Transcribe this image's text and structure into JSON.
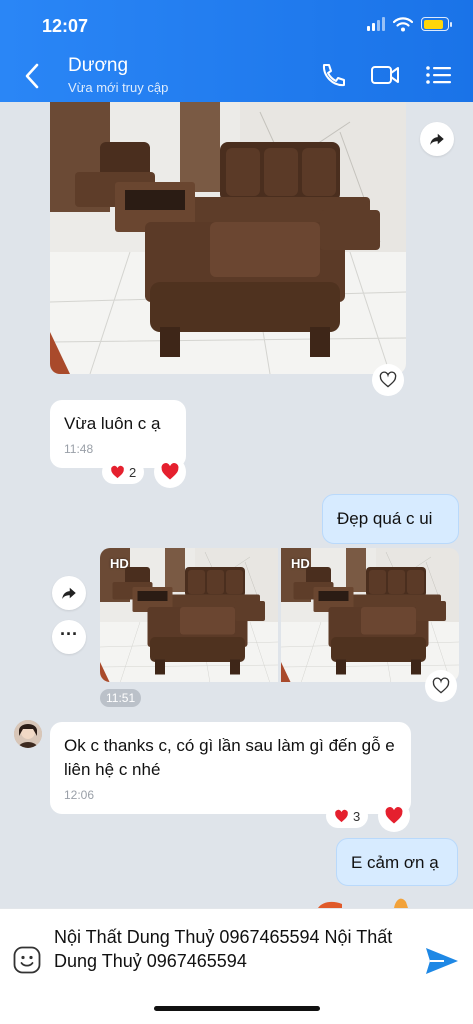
{
  "status_bar": {
    "time": "12:07",
    "battery_level": 0.85
  },
  "header": {
    "contact_name": "Dương",
    "contact_status": "Vừa mới truy cập",
    "icons": [
      "back-icon",
      "phone-icon",
      "video-call-icon",
      "menu-icon"
    ]
  },
  "messages": {
    "m1": {
      "text": "Vừa luôn c ạ",
      "time": "11:48",
      "reaction_count": "2"
    },
    "m2": {
      "text": "Đẹp quá c ui"
    },
    "m3": {
      "hd_label": "HD",
      "time": "11:51"
    },
    "m4": {
      "text": "Ok c thanks c, có gì lần sau làm gì đến gỗ e liên hệ c nhé",
      "time": "12:06",
      "reaction_count": "3"
    },
    "m5": {
      "text": "E cảm ơn ạ"
    }
  },
  "input": {
    "text": "Nội Thất Dung Thuỷ 0967465594 Nội Thất Dung Thuỷ 0967465594"
  },
  "colors": {
    "header": "#1a73e8",
    "outgoing_bubble": "#d7ebff",
    "heart": "#e5202e",
    "send": "#1e88e5"
  }
}
